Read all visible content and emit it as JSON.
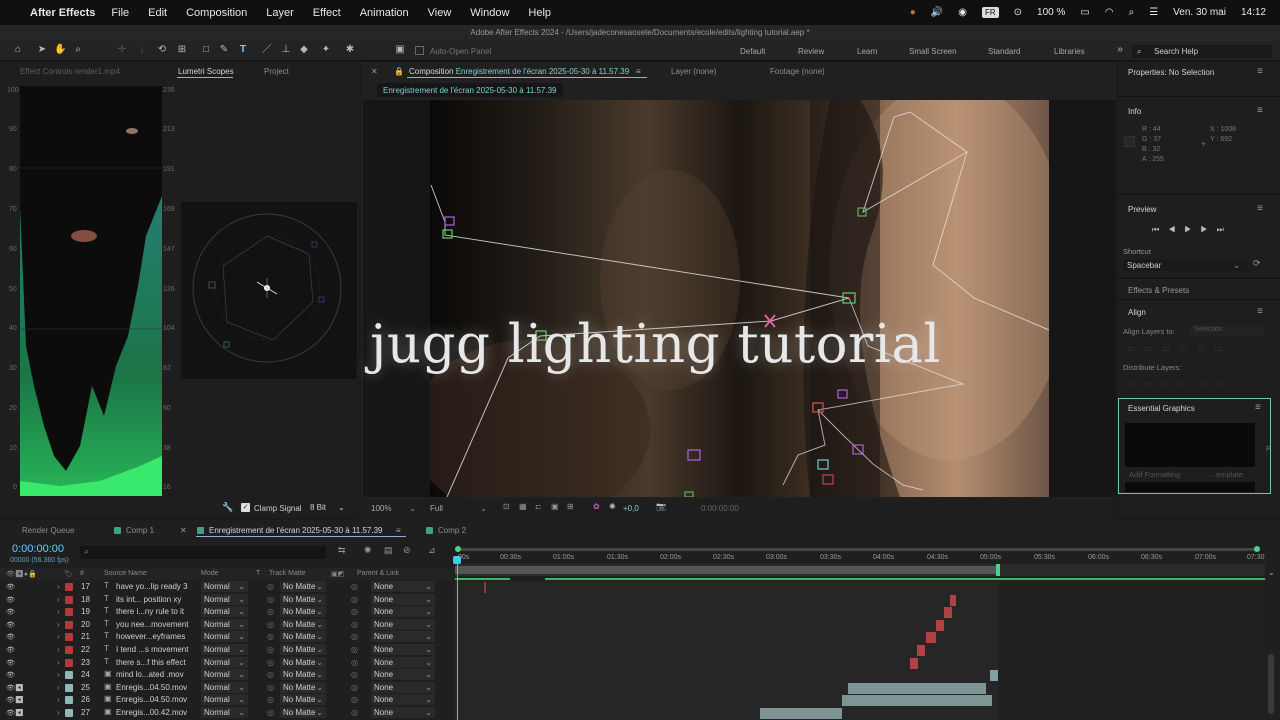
{
  "menubar": {
    "app": "After Effects",
    "items": [
      "File",
      "Edit",
      "Composition",
      "Layer",
      "Effect",
      "Animation",
      "View",
      "Window",
      "Help"
    ],
    "lang": "FR",
    "battery": "100 %",
    "date": "Ven. 30 mai",
    "time": "14:12"
  },
  "window": {
    "title": "Adobe After Effects 2024 - /Users/jadeconesaosete/Documents/ecole/edits/lighting tutorial.aep *"
  },
  "toolbar": {
    "auto_open": "Auto-Open Panel",
    "workspaces": [
      "Default",
      "Review",
      "Learn",
      "Small Screen",
      "Standard",
      "Libraries"
    ],
    "search": "Search Help"
  },
  "left_panel": {
    "tabs": [
      "Effect Controls render1.mp4",
      "Lumetri Scopes",
      "Project"
    ],
    "wave_left": [
      "100",
      "90",
      "80",
      "70",
      "60",
      "50",
      "40",
      "30",
      "20",
      "10",
      "0"
    ],
    "wave_right": [
      "235",
      "213",
      "191",
      "169",
      "147",
      "126",
      "104",
      "82",
      "60",
      "38",
      "16"
    ],
    "clamp": "Clamp Signal",
    "bits": "8 Bit"
  },
  "comp": {
    "tab_prefix": "Composition",
    "tab_name": "Enregistrement de l'écran 2025-05-30 à 11.57.39",
    "layer_tab": "Layer (none)",
    "footage_tab": "Footage (none)",
    "subtab": "Enregistrement de l'écran 2025-05-30 à 11.57.39",
    "headline": "jugg lighting tutorial",
    "zoom": "100%",
    "quality": "Full",
    "exposure": "+0,0",
    "timecode": "0:00:00:00"
  },
  "right_panel": {
    "properties": "Properties: No Selection",
    "info": "Info",
    "info_rgb": [
      "R : 44",
      "G : 37",
      "B : 32",
      "A : 255"
    ],
    "info_xy": [
      "X : 1008",
      "Y : 692"
    ],
    "preview": "Preview",
    "shortcut_label": "Shortcut",
    "shortcut": "Spacebar",
    "effects": "Effects & Presets",
    "align": "Align",
    "align_to": "Align Layers to:",
    "align_sel": "Selection",
    "distribute": "Distribute Layers:",
    "eg": "Essential Graphics",
    "eg_add": "Add Formatting",
    "eg_template": "...emplate"
  },
  "timeline": {
    "tabs": [
      "Render Queue",
      "Comp 1",
      "Enregistrement de l'écran 2025-05-30 à 11.57.39",
      "Comp 2"
    ],
    "timecode": "0:00:00:00",
    "fps": "00000 (56.360 fps)",
    "col_source": "Source Name",
    "col_mode": "Mode",
    "col_t": "T",
    "col_track": "Track Matte",
    "col_parent": "Parent & Link",
    "ruler": [
      "00s",
      "00:30s",
      "01:00s",
      "01:30s",
      "02:00s",
      "02:30s",
      "03:00s",
      "03:30s",
      "04:00s",
      "04:30s",
      "05:00s",
      "05:30s",
      "06:00s",
      "06:30s",
      "07:00s",
      "07:30"
    ],
    "layers": [
      {
        "num": "17",
        "type": "T",
        "name": "have yo...lip ready 3",
        "mode": "Normal",
        "matte": "No Matte",
        "parent": "None",
        "color": "#b23a3a"
      },
      {
        "num": "18",
        "type": "T",
        "name": "its int... position xy",
        "mode": "Normal",
        "matte": "No Matte",
        "parent": "None",
        "color": "#b23a3a"
      },
      {
        "num": "19",
        "type": "T",
        "name": "there i...ny rule to it",
        "mode": "Normal",
        "matte": "No Matte",
        "parent": "None",
        "color": "#b23a3a"
      },
      {
        "num": "20",
        "type": "T",
        "name": "you nee...movement",
        "mode": "Normal",
        "matte": "No Matte",
        "parent": "None",
        "color": "#b23a3a"
      },
      {
        "num": "21",
        "type": "T",
        "name": "however...eyframes",
        "mode": "Normal",
        "matte": "No Matte",
        "parent": "None",
        "color": "#b23a3a"
      },
      {
        "num": "22",
        "type": "T",
        "name": "I tend ...s movement",
        "mode": "Normal",
        "matte": "No Matte",
        "parent": "None",
        "color": "#b23a3a"
      },
      {
        "num": "23",
        "type": "T",
        "name": "there s...f this effect",
        "mode": "Normal",
        "matte": "No Matte",
        "parent": "None",
        "color": "#b23a3a"
      },
      {
        "num": "24",
        "type": "▣",
        "name": "mind lo...ated .mov",
        "mode": "Normal",
        "matte": "No Matte",
        "parent": "None",
        "color": "#8fb8b8"
      },
      {
        "num": "25",
        "type": "▣",
        "name": "Enregis...04.50.mov",
        "mode": "Normal",
        "matte": "No Matte",
        "parent": "None",
        "color": "#8fb8b8"
      },
      {
        "num": "26",
        "type": "▣",
        "name": "Enregis...04.50.mov",
        "mode": "Normal",
        "matte": "No Matte",
        "parent": "None",
        "color": "#8fb8b8"
      },
      {
        "num": "27",
        "type": "▣",
        "name": "Enregis...00.42.mov",
        "mode": "Normal",
        "matte": "No Matte",
        "parent": "None",
        "color": "#8fb8b8"
      }
    ]
  }
}
